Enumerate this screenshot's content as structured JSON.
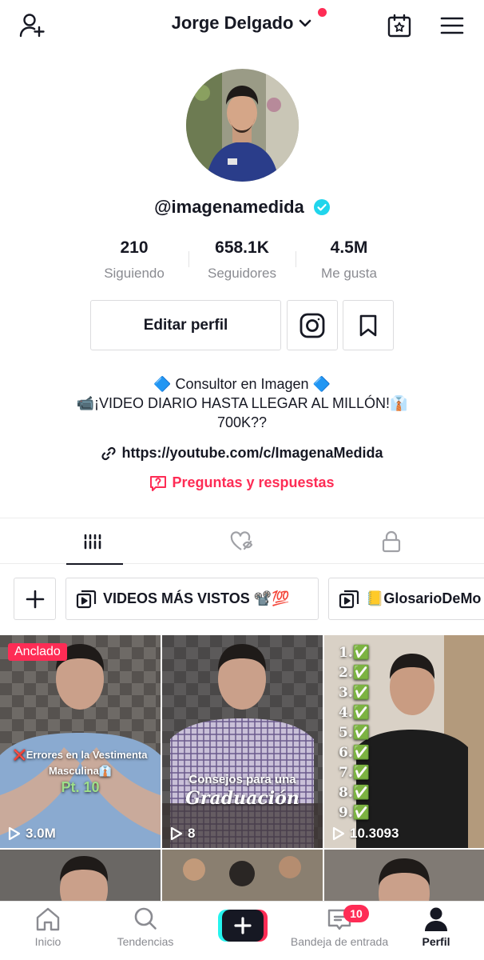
{
  "header": {
    "title": "Jorge Delgado",
    "has_notification_dot": true
  },
  "profile": {
    "username": "@imagenamedida",
    "verified": true,
    "stats": [
      {
        "value": "210",
        "label": "Siguiendo"
      },
      {
        "value": "658.1K",
        "label": "Seguidores"
      },
      {
        "value": "4.5M",
        "label": "Me gusta"
      }
    ],
    "edit_button": "Editar perfil",
    "bio_lines": [
      "🔷 Consultor en Imagen 🔷",
      "📹¡VIDEO DIARIO HASTA LLEGAR AL MILLÓN!👔",
      "700K??"
    ],
    "link": "https://youtube.com/c/ImagenaMedida",
    "qa_label": "Preguntas y respuestas"
  },
  "playlists": [
    {
      "label": "VIDEOS MÁS VISTOS 📽️💯"
    },
    {
      "label": "📒GlosarioDeMo"
    }
  ],
  "videos": [
    {
      "pinned_label": "Anclado",
      "views": "3.0M",
      "overlay": [
        "❌Errores en la Vestimenta",
        "Masculina👔",
        "Pt. 10"
      ]
    },
    {
      "views": "8",
      "overlay": [
        "Consejos para una",
        "Graduación"
      ]
    },
    {
      "views": "10.3093",
      "list": [
        "1.✅",
        "2.✅",
        "3.✅",
        "4.✅",
        "5.✅",
        "6.✅",
        "7.✅",
        "8.✅",
        "9.✅"
      ]
    }
  ],
  "nav": {
    "items": [
      {
        "label": "Inicio"
      },
      {
        "label": "Tendencias"
      },
      {
        "label": "Bandeja de entrada"
      },
      {
        "label": "Perfil"
      }
    ],
    "inbox_badge": "10"
  },
  "colors": {
    "accent": "#fe2c55",
    "verified": "#20d5ec",
    "text_primary": "#161823",
    "text_secondary": "#8a8b91"
  }
}
